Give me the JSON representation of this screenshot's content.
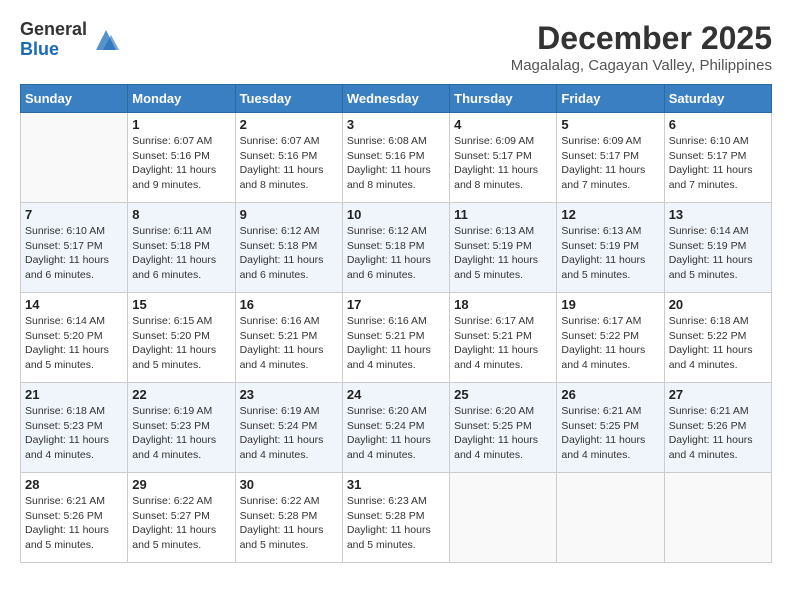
{
  "logo": {
    "general": "General",
    "blue": "Blue"
  },
  "title": "December 2025",
  "location": "Magalalag, Cagayan Valley, Philippines",
  "weekdays": [
    "Sunday",
    "Monday",
    "Tuesday",
    "Wednesday",
    "Thursday",
    "Friday",
    "Saturday"
  ],
  "weeks": [
    [
      {
        "day": "",
        "info": ""
      },
      {
        "day": "1",
        "info": "Sunrise: 6:07 AM\nSunset: 5:16 PM\nDaylight: 11 hours\nand 9 minutes."
      },
      {
        "day": "2",
        "info": "Sunrise: 6:07 AM\nSunset: 5:16 PM\nDaylight: 11 hours\nand 8 minutes."
      },
      {
        "day": "3",
        "info": "Sunrise: 6:08 AM\nSunset: 5:16 PM\nDaylight: 11 hours\nand 8 minutes."
      },
      {
        "day": "4",
        "info": "Sunrise: 6:09 AM\nSunset: 5:17 PM\nDaylight: 11 hours\nand 8 minutes."
      },
      {
        "day": "5",
        "info": "Sunrise: 6:09 AM\nSunset: 5:17 PM\nDaylight: 11 hours\nand 7 minutes."
      },
      {
        "day": "6",
        "info": "Sunrise: 6:10 AM\nSunset: 5:17 PM\nDaylight: 11 hours\nand 7 minutes."
      }
    ],
    [
      {
        "day": "7",
        "info": "Sunrise: 6:10 AM\nSunset: 5:17 PM\nDaylight: 11 hours\nand 6 minutes."
      },
      {
        "day": "8",
        "info": "Sunrise: 6:11 AM\nSunset: 5:18 PM\nDaylight: 11 hours\nand 6 minutes."
      },
      {
        "day": "9",
        "info": "Sunrise: 6:12 AM\nSunset: 5:18 PM\nDaylight: 11 hours\nand 6 minutes."
      },
      {
        "day": "10",
        "info": "Sunrise: 6:12 AM\nSunset: 5:18 PM\nDaylight: 11 hours\nand 6 minutes."
      },
      {
        "day": "11",
        "info": "Sunrise: 6:13 AM\nSunset: 5:19 PM\nDaylight: 11 hours\nand 5 minutes."
      },
      {
        "day": "12",
        "info": "Sunrise: 6:13 AM\nSunset: 5:19 PM\nDaylight: 11 hours\nand 5 minutes."
      },
      {
        "day": "13",
        "info": "Sunrise: 6:14 AM\nSunset: 5:19 PM\nDaylight: 11 hours\nand 5 minutes."
      }
    ],
    [
      {
        "day": "14",
        "info": "Sunrise: 6:14 AM\nSunset: 5:20 PM\nDaylight: 11 hours\nand 5 minutes."
      },
      {
        "day": "15",
        "info": "Sunrise: 6:15 AM\nSunset: 5:20 PM\nDaylight: 11 hours\nand 5 minutes."
      },
      {
        "day": "16",
        "info": "Sunrise: 6:16 AM\nSunset: 5:21 PM\nDaylight: 11 hours\nand 4 minutes."
      },
      {
        "day": "17",
        "info": "Sunrise: 6:16 AM\nSunset: 5:21 PM\nDaylight: 11 hours\nand 4 minutes."
      },
      {
        "day": "18",
        "info": "Sunrise: 6:17 AM\nSunset: 5:21 PM\nDaylight: 11 hours\nand 4 minutes."
      },
      {
        "day": "19",
        "info": "Sunrise: 6:17 AM\nSunset: 5:22 PM\nDaylight: 11 hours\nand 4 minutes."
      },
      {
        "day": "20",
        "info": "Sunrise: 6:18 AM\nSunset: 5:22 PM\nDaylight: 11 hours\nand 4 minutes."
      }
    ],
    [
      {
        "day": "21",
        "info": "Sunrise: 6:18 AM\nSunset: 5:23 PM\nDaylight: 11 hours\nand 4 minutes."
      },
      {
        "day": "22",
        "info": "Sunrise: 6:19 AM\nSunset: 5:23 PM\nDaylight: 11 hours\nand 4 minutes."
      },
      {
        "day": "23",
        "info": "Sunrise: 6:19 AM\nSunset: 5:24 PM\nDaylight: 11 hours\nand 4 minutes."
      },
      {
        "day": "24",
        "info": "Sunrise: 6:20 AM\nSunset: 5:24 PM\nDaylight: 11 hours\nand 4 minutes."
      },
      {
        "day": "25",
        "info": "Sunrise: 6:20 AM\nSunset: 5:25 PM\nDaylight: 11 hours\nand 4 minutes."
      },
      {
        "day": "26",
        "info": "Sunrise: 6:21 AM\nSunset: 5:25 PM\nDaylight: 11 hours\nand 4 minutes."
      },
      {
        "day": "27",
        "info": "Sunrise: 6:21 AM\nSunset: 5:26 PM\nDaylight: 11 hours\nand 4 minutes."
      }
    ],
    [
      {
        "day": "28",
        "info": "Sunrise: 6:21 AM\nSunset: 5:26 PM\nDaylight: 11 hours\nand 5 minutes."
      },
      {
        "day": "29",
        "info": "Sunrise: 6:22 AM\nSunset: 5:27 PM\nDaylight: 11 hours\nand 5 minutes."
      },
      {
        "day": "30",
        "info": "Sunrise: 6:22 AM\nSunset: 5:28 PM\nDaylight: 11 hours\nand 5 minutes."
      },
      {
        "day": "31",
        "info": "Sunrise: 6:23 AM\nSunset: 5:28 PM\nDaylight: 11 hours\nand 5 minutes."
      },
      {
        "day": "",
        "info": ""
      },
      {
        "day": "",
        "info": ""
      },
      {
        "day": "",
        "info": ""
      }
    ]
  ]
}
